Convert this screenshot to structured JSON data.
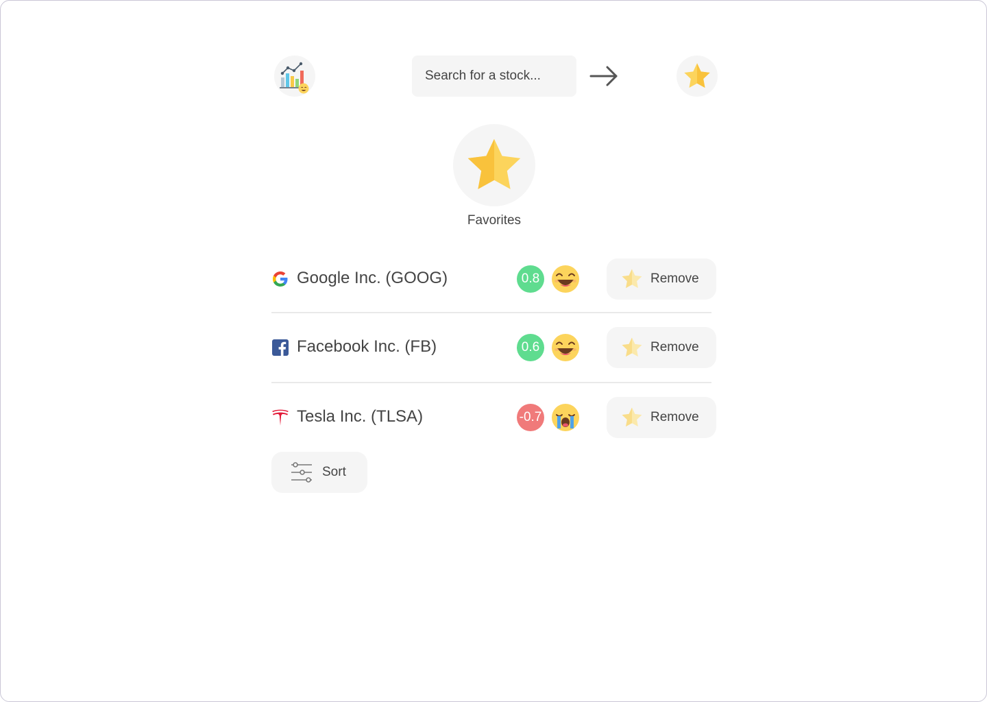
{
  "header": {
    "logo_icon": "stock-chart-emoji-icon",
    "search_placeholder": "Search for a stock...",
    "search_value": "",
    "go_icon": "arrow-right-icon",
    "favorites_icon": "star-icon"
  },
  "favorites": {
    "icon": "star-icon",
    "title": "Favorites"
  },
  "stocks": [
    {
      "name": "Google Inc. (GOOG)",
      "brand_icon": "google-icon",
      "score": "0.8",
      "score_color": "#5fdc8f",
      "sentiment_icon": "happy-face-icon",
      "remove_label": "Remove"
    },
    {
      "name": "Facebook Inc. (FB)",
      "brand_icon": "facebook-icon",
      "score": "0.6",
      "score_color": "#5fdc8f",
      "sentiment_icon": "happy-face-icon",
      "remove_label": "Remove"
    },
    {
      "name": "Tesla Inc. (TLSA)",
      "brand_icon": "tesla-icon",
      "score": "-0.7",
      "score_color": "#f07a7a",
      "sentiment_icon": "crying-face-icon",
      "remove_label": "Remove"
    }
  ],
  "sort": {
    "label": "Sort",
    "icon": "sliders-icon"
  },
  "colors": {
    "positive": "#5fdc8f",
    "negative": "#f07a7a",
    "star": "#fcd45c",
    "button_bg": "#f5f5f5"
  }
}
